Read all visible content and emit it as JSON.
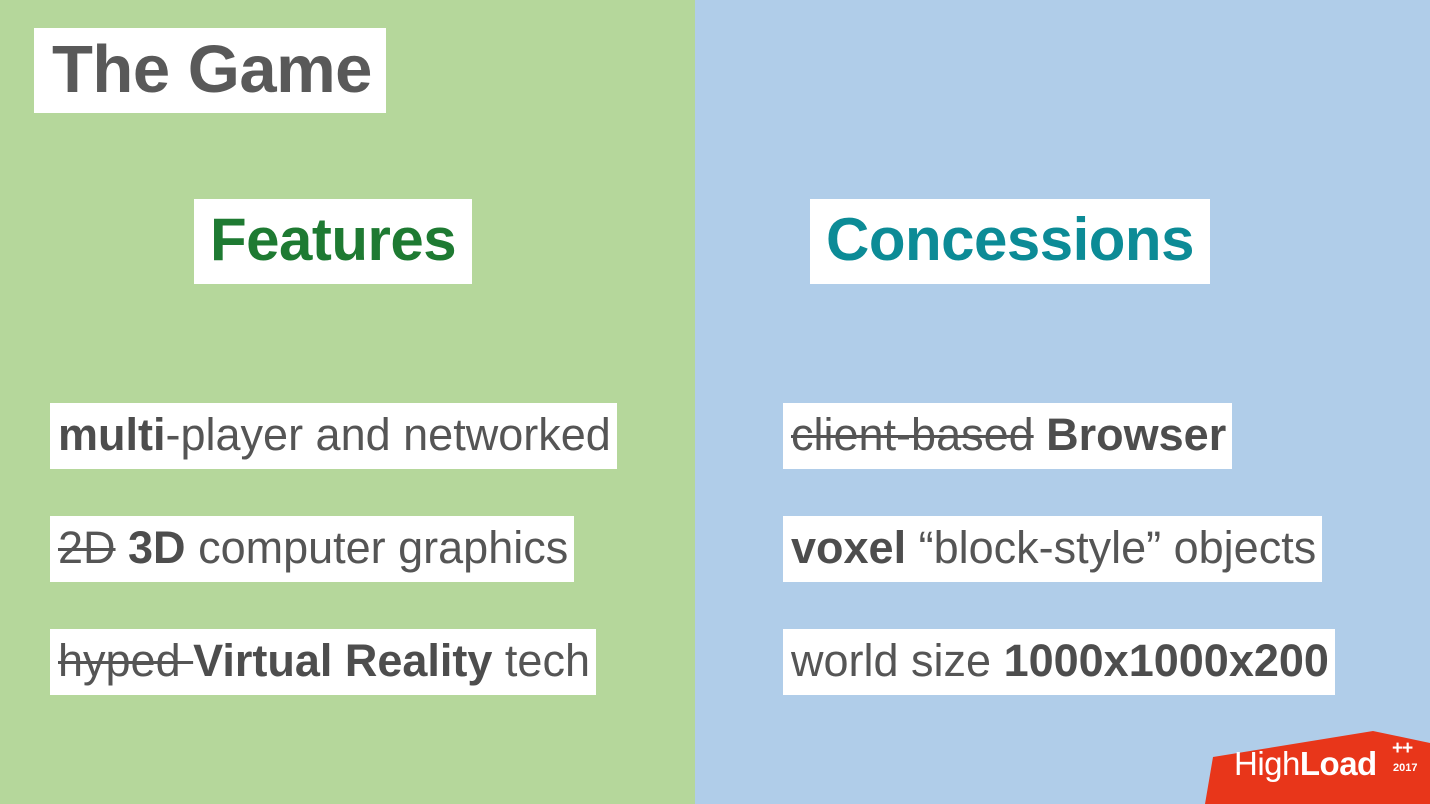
{
  "slide": {
    "title": "The Game",
    "background": {
      "left_color": "#b5d79b",
      "right_color": "#b0cde9"
    }
  },
  "columns": {
    "left": {
      "heading": "Features",
      "heading_color": "#1e7a32",
      "items": [
        {
          "strike": "",
          "bold": "multi",
          "rest": "-player and networked",
          "plain_text": "multi-player and networked"
        },
        {
          "strike": "2D",
          "bold": " 3D",
          "rest": " computer graphics",
          "plain_text": "2D 3D computer graphics"
        },
        {
          "strike": "hyped ",
          "bold": "Virtual Reality",
          "rest": " tech",
          "plain_text": "hyped Virtual Reality tech"
        }
      ]
    },
    "right": {
      "heading": "Concessions",
      "heading_color": "#0c8b96",
      "items": [
        {
          "strike": "client-based",
          "bold": " Browser",
          "rest": "",
          "plain_text": "client-based Browser"
        },
        {
          "strike": "",
          "bold": "voxel",
          "rest": " “block-style” objects",
          "plain_text": "voxel “block-style” objects"
        },
        {
          "strike": "",
          "bold": "",
          "rest": "world size ",
          "bold_tail": "1000x1000x200",
          "plain_text": "world size 1000x1000x200"
        }
      ]
    }
  },
  "logo": {
    "name": "HighLoad++ 2017",
    "part_light": "High",
    "part_bold": "Load",
    "plus": "++",
    "year": "2017",
    "color": "#e8361a"
  }
}
